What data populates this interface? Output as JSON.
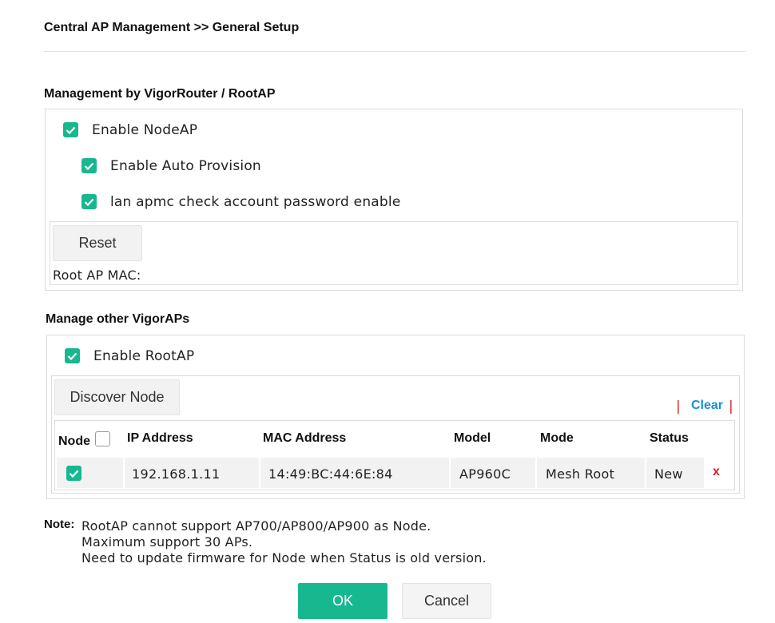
{
  "page": {
    "title": "Central AP Management >> General Setup"
  },
  "management": {
    "heading": "Management by VigorRouter / RootAP",
    "enable_nodeap": {
      "label": "Enable NodeAP",
      "checked": true
    },
    "enable_auto_provision": {
      "label": "Enable Auto Provision",
      "checked": true
    },
    "lan_apmc_check": {
      "label": "lan apmc check account password enable",
      "checked": true
    },
    "reset_label": "Reset",
    "root_ap_mac_label": "Root AP MAC:"
  },
  "manage_other": {
    "heading": "Manage other VigorAPs",
    "enable_rootap": {
      "label": "Enable RootAP",
      "checked": true
    },
    "discover_label": "Discover Node",
    "separator": "|",
    "clear_label": "Clear",
    "columns": [
      "Node",
      "IP Address",
      "MAC Address",
      "Model",
      "Mode",
      "Status"
    ],
    "rows": [
      {
        "checked": true,
        "ip": "192.168.1.11",
        "mac": "14:49:BC:44:6E:84",
        "model": "AP960C",
        "mode": "Mesh Root",
        "status": "New",
        "delete": "x"
      }
    ]
  },
  "note": {
    "label": "Note:",
    "lines": [
      "RootAP cannot support AP700/AP800/AP900 as Node.",
      "Maximum support 30 APs.",
      "Need to update firmware for Node when Status is old version."
    ]
  },
  "footer": {
    "ok_label": "OK",
    "cancel_label": "Cancel"
  },
  "colors": {
    "accent": "#17b890",
    "link": "#1a8fd6",
    "danger": "#e02020"
  }
}
